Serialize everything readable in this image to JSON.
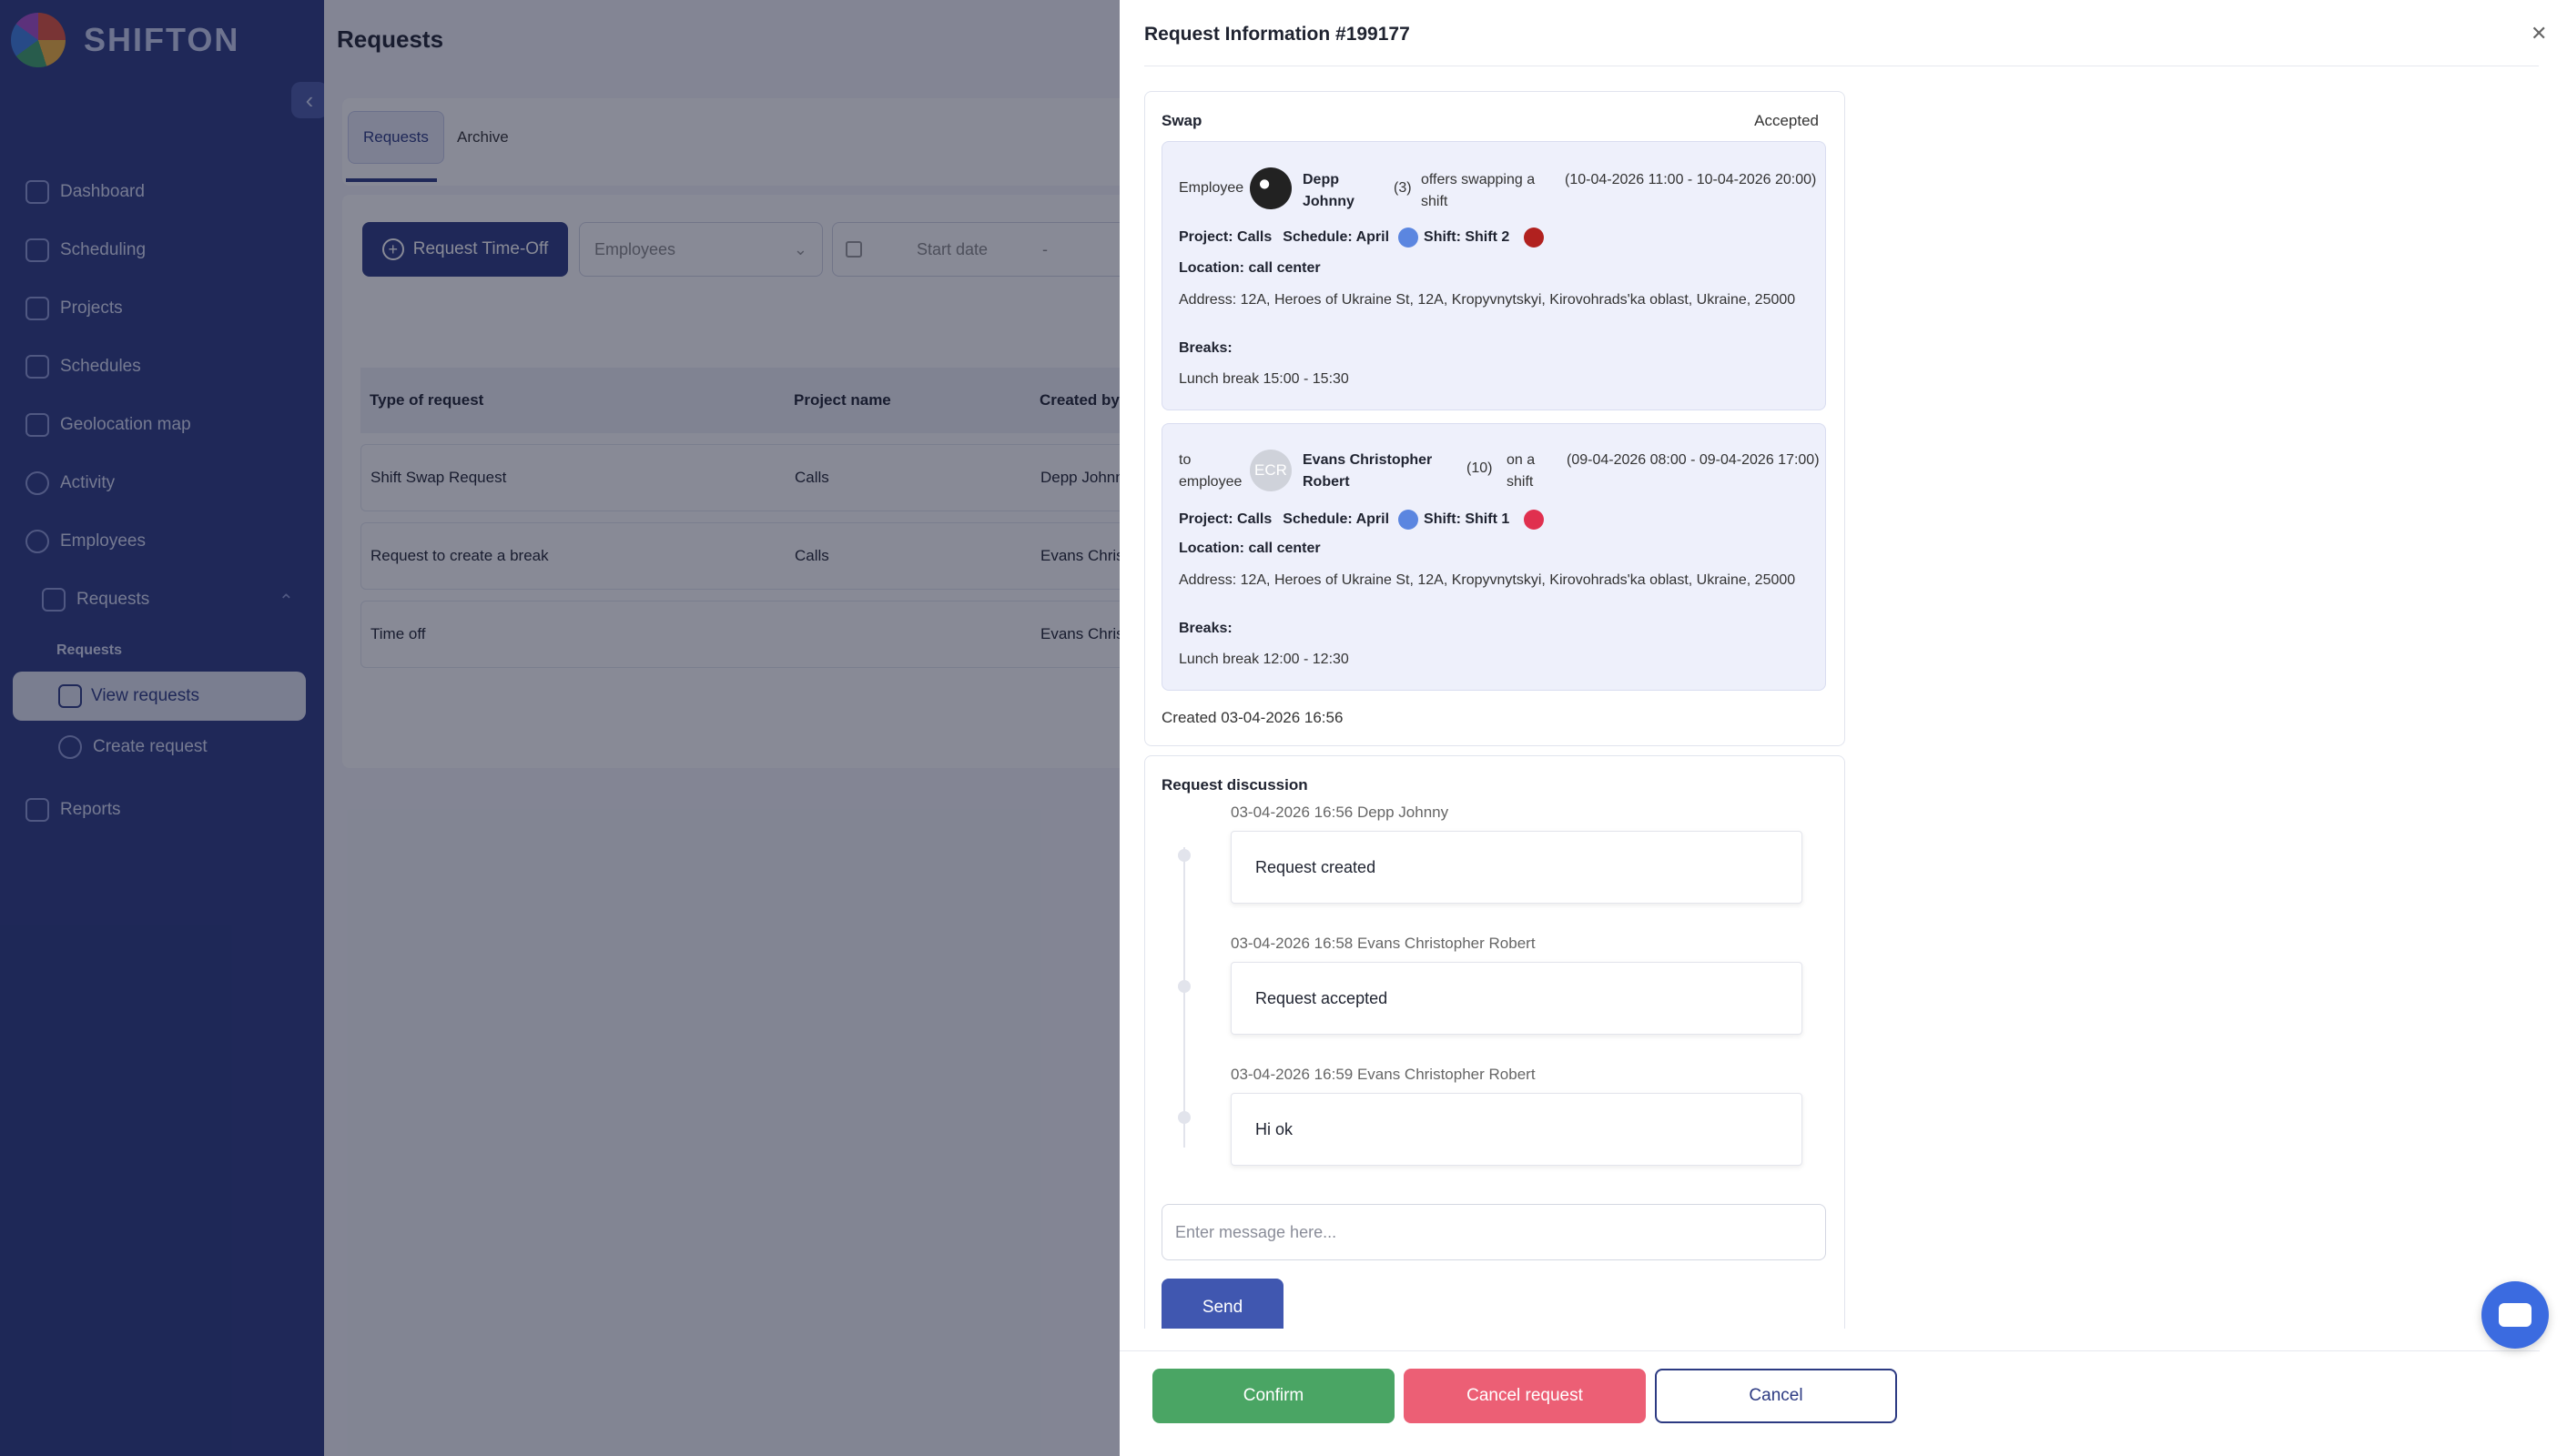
{
  "app": {
    "brand": "SHIFTON"
  },
  "sidebar": {
    "items": [
      {
        "label": "Dashboard"
      },
      {
        "label": "Scheduling"
      },
      {
        "label": "Projects"
      },
      {
        "label": "Schedules"
      },
      {
        "label": "Geolocation map"
      },
      {
        "label": "Activity"
      },
      {
        "label": "Employees"
      },
      {
        "label": "Requests"
      },
      {
        "label": "Reports"
      }
    ],
    "sub_heading": "Requests",
    "sub_items": [
      {
        "label": "View requests"
      },
      {
        "label": "Create request"
      }
    ]
  },
  "page": {
    "title": "Requests",
    "tabs": [
      "Requests",
      "Archive"
    ],
    "request_timeoff_label": "Request Time-Off",
    "employees_placeholder": "Employees",
    "start_date_placeholder": "Start date",
    "date_sep": "-",
    "table": {
      "headers": [
        "Type of request",
        "Project name",
        "Created by"
      ],
      "rows": [
        [
          "Shift Swap Request",
          "Calls",
          "Depp Johnn"
        ],
        [
          "Request to create a break",
          "Calls",
          "Evans Chris"
        ],
        [
          "Time off",
          "",
          "Evans Chris"
        ]
      ]
    }
  },
  "drawer": {
    "title": "Request Information #199177",
    "swap": {
      "label": "Swap",
      "status": "Accepted",
      "from": {
        "prefix": "Employee",
        "name": "Depp Johnny",
        "count": "(3)",
        "action": "offers swapping a shift",
        "period": "(10-04-2026 11:00 - 10-04-2026 20:00)",
        "project": "Project: Calls",
        "schedule": "Schedule: April",
        "shift": "Shift: Shift 2",
        "location": "Location: call center",
        "address": "Address: 12A, Heroes of Ukraine St, 12A, Kropyvnytskyi, Kirovohrads'ka oblast, Ukraine, 25000",
        "breaks_label": "Breaks:",
        "break": "Lunch break 15:00 - 15:30",
        "schedule_color": "#5b86e0",
        "shift_color": "#b1211f"
      },
      "to": {
        "prefix": "to employee",
        "avatar": "ECR",
        "name": "Evans Christopher Robert",
        "count": "(10)",
        "action": "on a shift",
        "period": "(09-04-2026 08:00 - 09-04-2026 17:00)",
        "project": "Project: Calls",
        "schedule": "Schedule: April",
        "shift": "Shift: Shift 1",
        "location": "Location: call center",
        "address": "Address: 12A, Heroes of Ukraine St, 12A, Kropyvnytskyi, Kirovohrads'ka oblast, Ukraine, 25000",
        "breaks_label": "Breaks:",
        "break": "Lunch break 12:00 - 12:30",
        "schedule_color": "#5b86e0",
        "shift_color": "#e0304f"
      },
      "created": "Created 03-04-2026 16:56"
    },
    "discussion": {
      "title": "Request discussion",
      "messages": [
        {
          "meta": "03-04-2026 16:56 Depp Johnny",
          "text": "Request created"
        },
        {
          "meta": "03-04-2026 16:58 Evans Christopher Robert",
          "text": "Request accepted"
        },
        {
          "meta": "03-04-2026 16:59 Evans Christopher Robert",
          "text": "Hi ok"
        }
      ],
      "input_placeholder": "Enter message here...",
      "send_label": "Send"
    },
    "footer": {
      "confirm": "Confirm",
      "cancel_request": "Cancel request",
      "cancel": "Cancel"
    }
  }
}
